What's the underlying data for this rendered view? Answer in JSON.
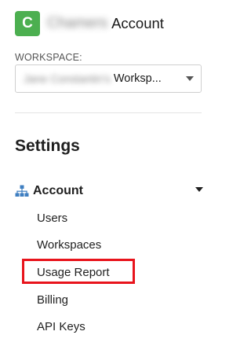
{
  "header": {
    "logo_letter": "C",
    "account_name": "Chamers",
    "title": "Account"
  },
  "workspace": {
    "label": "WORKSPACE:",
    "selected_blurred": "Jane Constantin's",
    "selected_visible": "Worksp..."
  },
  "settings": {
    "heading": "Settings"
  },
  "account_group": {
    "label": "Account",
    "icon": "sitemap-icon"
  },
  "submenu": {
    "users": "Users",
    "workspaces": "Workspaces",
    "usage_report": "Usage Report",
    "billing": "Billing",
    "api_keys": "API Keys"
  },
  "colors": {
    "logo_bg": "#4caf50",
    "icon_blue": "#3f7fc1",
    "highlight": "#e8141c"
  }
}
